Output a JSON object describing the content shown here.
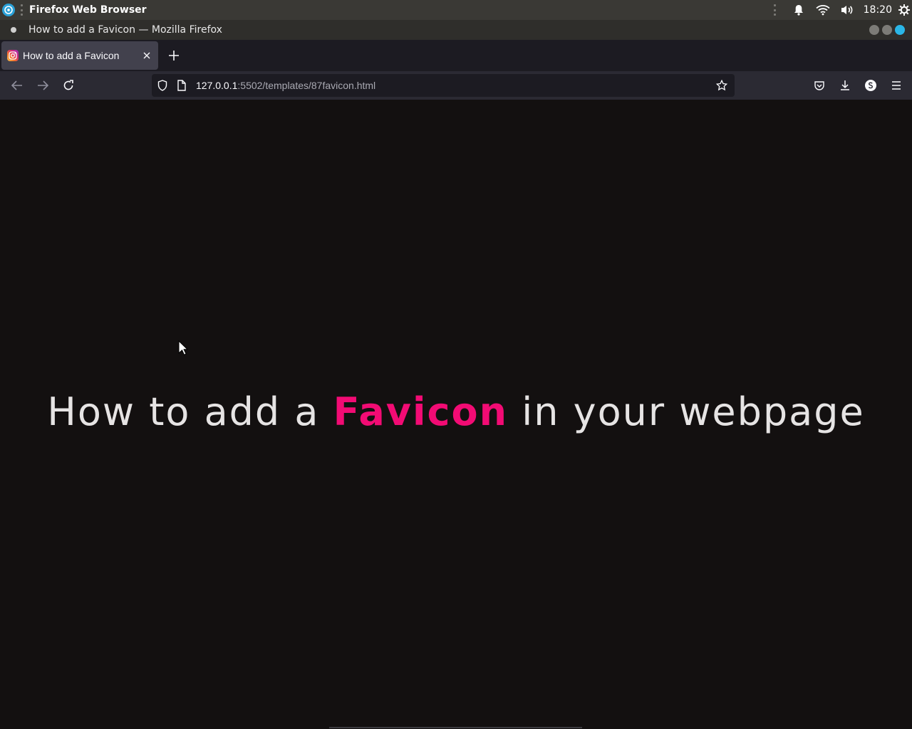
{
  "system_bar": {
    "app_name": "Firefox Web Browser",
    "clock": "18:20",
    "icons": [
      "notification-bell-icon",
      "wifi-icon",
      "volume-icon",
      "settings-gear-icon"
    ]
  },
  "window": {
    "title": "How to add a Favicon — Mozilla Firefox"
  },
  "tabs": [
    {
      "label": "How to add a Favicon",
      "favicon": "instagram-icon",
      "active": true
    }
  ],
  "toolbar": {
    "new_tab_icon": "plus-icon",
    "back_icon": "back-arrow-icon",
    "forward_icon": "forward-arrow-icon",
    "reload_icon": "reload-icon"
  },
  "url_bar": {
    "host": "127.0.0.1",
    "rest": ":5502/templates/87favicon.html"
  },
  "page": {
    "headline_before": "How to add a ",
    "headline_highlight": "Favicon",
    "headline_after": " in your webpage",
    "highlight_color": "#f20b74",
    "background_color": "#131010"
  }
}
